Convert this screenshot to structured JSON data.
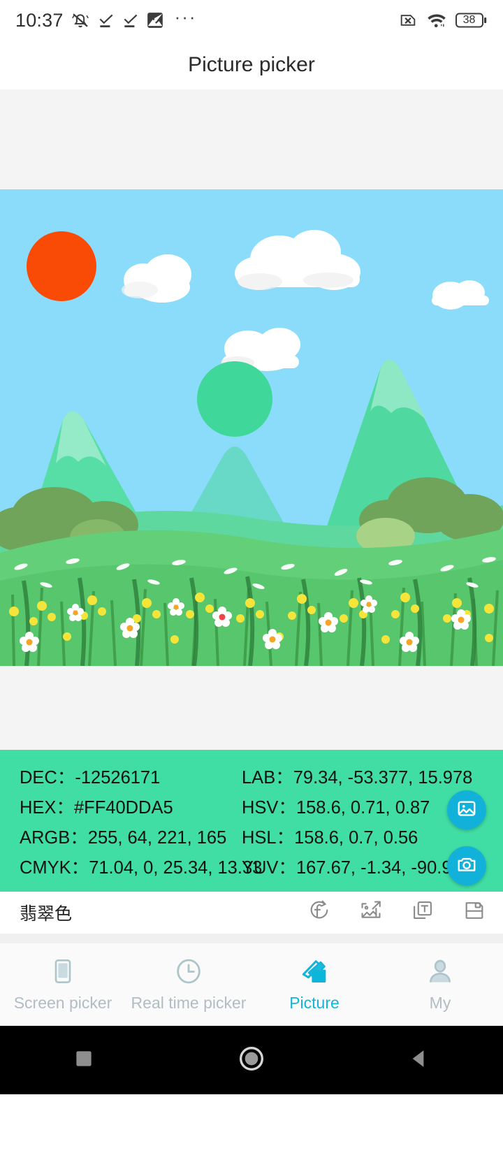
{
  "status_bar": {
    "time": "10:37",
    "icons_left": [
      "bell-mute-icon",
      "check-underline-icon",
      "check-underline-icon",
      "image-download-icon",
      "more-dots-icon"
    ],
    "icons_right": [
      "no-sim-icon",
      "wifi-icon",
      "battery-icon"
    ],
    "battery_level": "38"
  },
  "header": {
    "title": "Picture picker"
  },
  "stage": {
    "image_alt": "landscape-illustration",
    "background": "#f4f4f4"
  },
  "color_panel": {
    "background": "#40DDA5",
    "rows": [
      {
        "left_label": "DEC：",
        "left_value": "-12526171",
        "right_label": "LAB：",
        "right_value": "79.34, -53.377, 15.978"
      },
      {
        "left_label": "HEX：",
        "left_value": "#FF40DDA5",
        "right_label": "HSV：",
        "right_value": "158.6, 0.71, 0.87"
      },
      {
        "left_label": "ARGB：",
        "left_value": "255, 64, 221, 165",
        "right_label": "HSL：",
        "right_value": "158.6, 0.7, 0.56"
      },
      {
        "left_label": "CMYK：",
        "left_value": "71.04, 0, 25.34, 13.33",
        "right_label": "YUV：",
        "right_value": "167.67, -1.34, -90.95"
      }
    ],
    "fabs": [
      {
        "name": "pick-image-fab",
        "icon": "image-icon",
        "color": "#12B1DA"
      },
      {
        "name": "camera-fab",
        "icon": "camera-icon",
        "color": "#12B1DA"
      }
    ]
  },
  "action_bar": {
    "color_name": "翡翠色",
    "actions": [
      {
        "name": "convert-color-button",
        "icon": "circle-f-refresh-icon"
      },
      {
        "name": "export-image-button",
        "icon": "image-export-icon"
      },
      {
        "name": "copy-text-button",
        "icon": "copy-text-icon"
      },
      {
        "name": "save-button",
        "icon": "floppy-save-icon"
      }
    ]
  },
  "bottom_nav": {
    "active_color": "#12B5D8",
    "inactive_color": "#B0BEC4",
    "items": [
      {
        "name": "tab-screen-picker",
        "label": "Screen picker",
        "icon": "phone-screen-icon",
        "active": false
      },
      {
        "name": "tab-real-time-picker",
        "label": "Real time picker",
        "icon": "clock-icon",
        "active": false
      },
      {
        "name": "tab-picture",
        "label": "Picture",
        "icon": "pictures-stack-icon",
        "active": true
      },
      {
        "name": "tab-my",
        "label": "My",
        "icon": "person-icon",
        "active": false
      }
    ]
  },
  "system_nav": {
    "buttons": [
      {
        "name": "recents-button",
        "icon": "square-icon"
      },
      {
        "name": "home-button",
        "icon": "circle-icon"
      },
      {
        "name": "back-button",
        "icon": "triangle-back-icon"
      }
    ]
  }
}
